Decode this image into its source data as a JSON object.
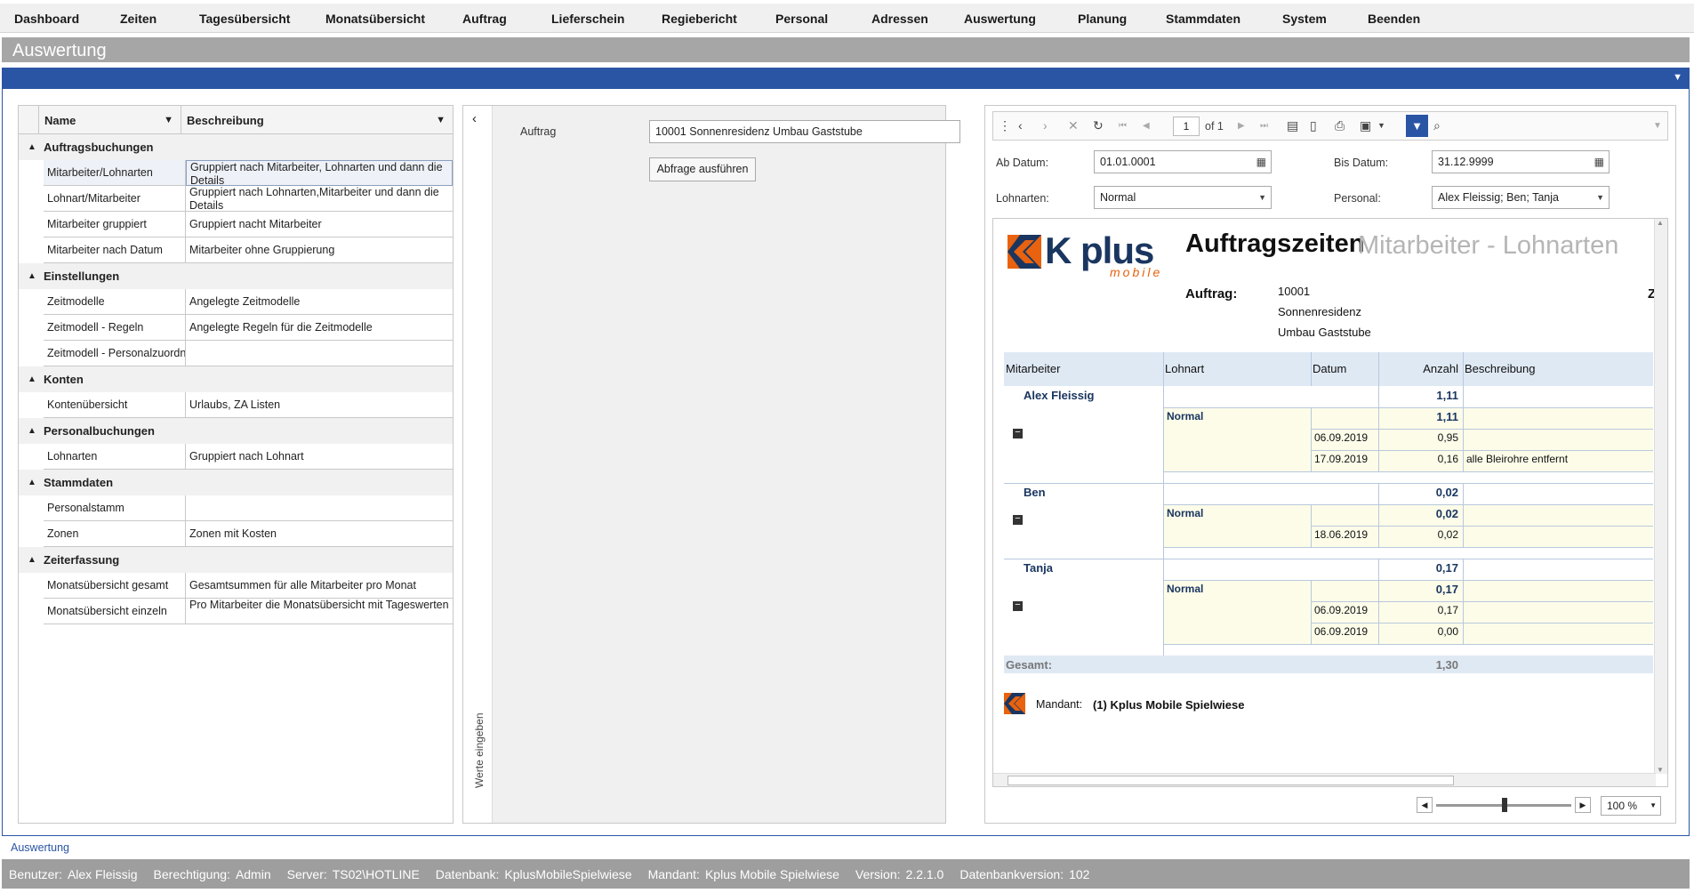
{
  "menu": [
    "Dashboard",
    "Zeiten",
    "Tagesübersicht",
    "Monatsübersicht",
    "Auftrag",
    "Lieferschein",
    "Regiebericht",
    "Personal",
    "Adressen",
    "Auswertung",
    "Planung",
    "Stammdaten",
    "System",
    "Beenden"
  ],
  "title": "Auswertung",
  "tree": {
    "col_name": "Name",
    "col_desc": "Beschreibung",
    "groups": [
      {
        "label": "Auftragsbuchungen",
        "rows": [
          {
            "name": "Mitarbeiter/Lohnarten",
            "desc": "Gruppiert nach Mitarbeiter, Lohnarten und dann die Details"
          },
          {
            "name": "Lohnart/Mitarbeiter",
            "desc": "Gruppiert nach Lohnarten,Mitarbeiter und dann die Details"
          },
          {
            "name": "Mitarbeiter gruppiert",
            "desc": "Gruppiert nacht Mitarbeiter"
          },
          {
            "name": "Mitarbeiter nach Datum",
            "desc": "Mitarbeiter ohne Gruppierung"
          }
        ]
      },
      {
        "label": "Einstellungen",
        "rows": [
          {
            "name": "Zeitmodelle",
            "desc": "Angelegte Zeitmodelle"
          },
          {
            "name": "Zeitmodell - Regeln",
            "desc": "Angelegte Regeln für die Zeitmodelle"
          },
          {
            "name": "Zeitmodell - Personalzuordn",
            "desc": ""
          }
        ]
      },
      {
        "label": "Konten",
        "rows": [
          {
            "name": "Kontenübersicht",
            "desc": "Urlaubs, ZA Listen"
          }
        ]
      },
      {
        "label": "Personalbuchungen",
        "rows": [
          {
            "name": "Lohnarten",
            "desc": "Gruppiert nach Lohnart"
          }
        ]
      },
      {
        "label": "Stammdaten",
        "rows": [
          {
            "name": "Personalstamm",
            "desc": ""
          },
          {
            "name": "Zonen",
            "desc": "Zonen mit Kosten"
          }
        ]
      },
      {
        "label": "Zeiterfassung",
        "rows": [
          {
            "name": "Monatsübersicht gesamt",
            "desc": "Gesamtsummen für alle Mitarbeiter pro Monat"
          },
          {
            "name": "Monatsübersicht einzeln",
            "desc": "Pro Mitarbeiter die Monatsübersicht mit Tageswerten"
          }
        ]
      }
    ]
  },
  "params": {
    "label": "Auftrag",
    "value": "10001 Sonnenresidenz Umbau Gaststube",
    "button": "Abfrage ausführen",
    "side_label": "Werte eingeben"
  },
  "viewer": {
    "page": "1",
    "of": "of 1",
    "ab_datum_label": "Ab Datum:",
    "ab_datum": "01.01.0001",
    "bis_datum_label": "Bis Datum:",
    "bis_datum": "31.12.9999",
    "lohnarten_label": "Lohnarten:",
    "lohnarten": "Normal",
    "personal_label": "Personal:",
    "personal": "Alex Fleissig; Ben; Tanja",
    "zoom": "100 %"
  },
  "report": {
    "logo_text": "K plus",
    "logo_sub": "mobile",
    "title": "Auftragszeiten",
    "subtitle": "Mitarbeiter - Lohnarten",
    "auftrag_label": "Auftrag:",
    "auftrag_nr": "10001",
    "auftrag_line1": "Sonnenresidenz",
    "auftrag_line2": "Umbau Gaststube",
    "edge_char": "Z",
    "cols": [
      "Mitarbeiter",
      "Lohnart",
      "Datum",
      "Anzahl",
      "Beschreibung"
    ],
    "employees": [
      {
        "name": "Alex Fleissig",
        "total": "1,11",
        "lohnart": "Normal",
        "lohnart_total": "1,11",
        "details": [
          {
            "date": "06.09.2019",
            "val": "0,95",
            "desc": ""
          },
          {
            "date": "17.09.2019",
            "val": "0,16",
            "desc": "alle Bleirohre entfernt"
          }
        ]
      },
      {
        "name": "Ben",
        "total": "0,02",
        "lohnart": "Normal",
        "lohnart_total": "0,02",
        "details": [
          {
            "date": "18.06.2019",
            "val": "0,02",
            "desc": ""
          }
        ]
      },
      {
        "name": "Tanja",
        "total": "0,17",
        "lohnart": "Normal",
        "lohnart_total": "0,17",
        "details": [
          {
            "date": "06.09.2019",
            "val": "0,17",
            "desc": ""
          },
          {
            "date": "06.09.2019",
            "val": "0,00",
            "desc": ""
          }
        ]
      }
    ],
    "gesamt_label": "Gesamt:",
    "gesamt": "1,30",
    "mandant_label": "Mandant:",
    "mandant": "(1) Kplus Mobile Spielwiese"
  },
  "footer_link": "Auswertung",
  "status": [
    {
      "label": "Benutzer:",
      "value": "Alex Fleissig"
    },
    {
      "label": "Berechtigung:",
      "value": "Admin"
    },
    {
      "label": "Server:",
      "value": "TS02\\HOTLINE"
    },
    {
      "label": "Datenbank:",
      "value": "KplusMobileSpielwiese"
    },
    {
      "label": "Mandant:",
      "value": "Kplus Mobile Spielwiese"
    },
    {
      "label": "Version:",
      "value": "2.2.1.0"
    },
    {
      "label": "Datenbankversion:",
      "value": "102"
    }
  ],
  "colors": {
    "brand_blue": "#2a55a5",
    "logo_orange": "#e8620f",
    "title_gray": "#a6a6a6"
  }
}
